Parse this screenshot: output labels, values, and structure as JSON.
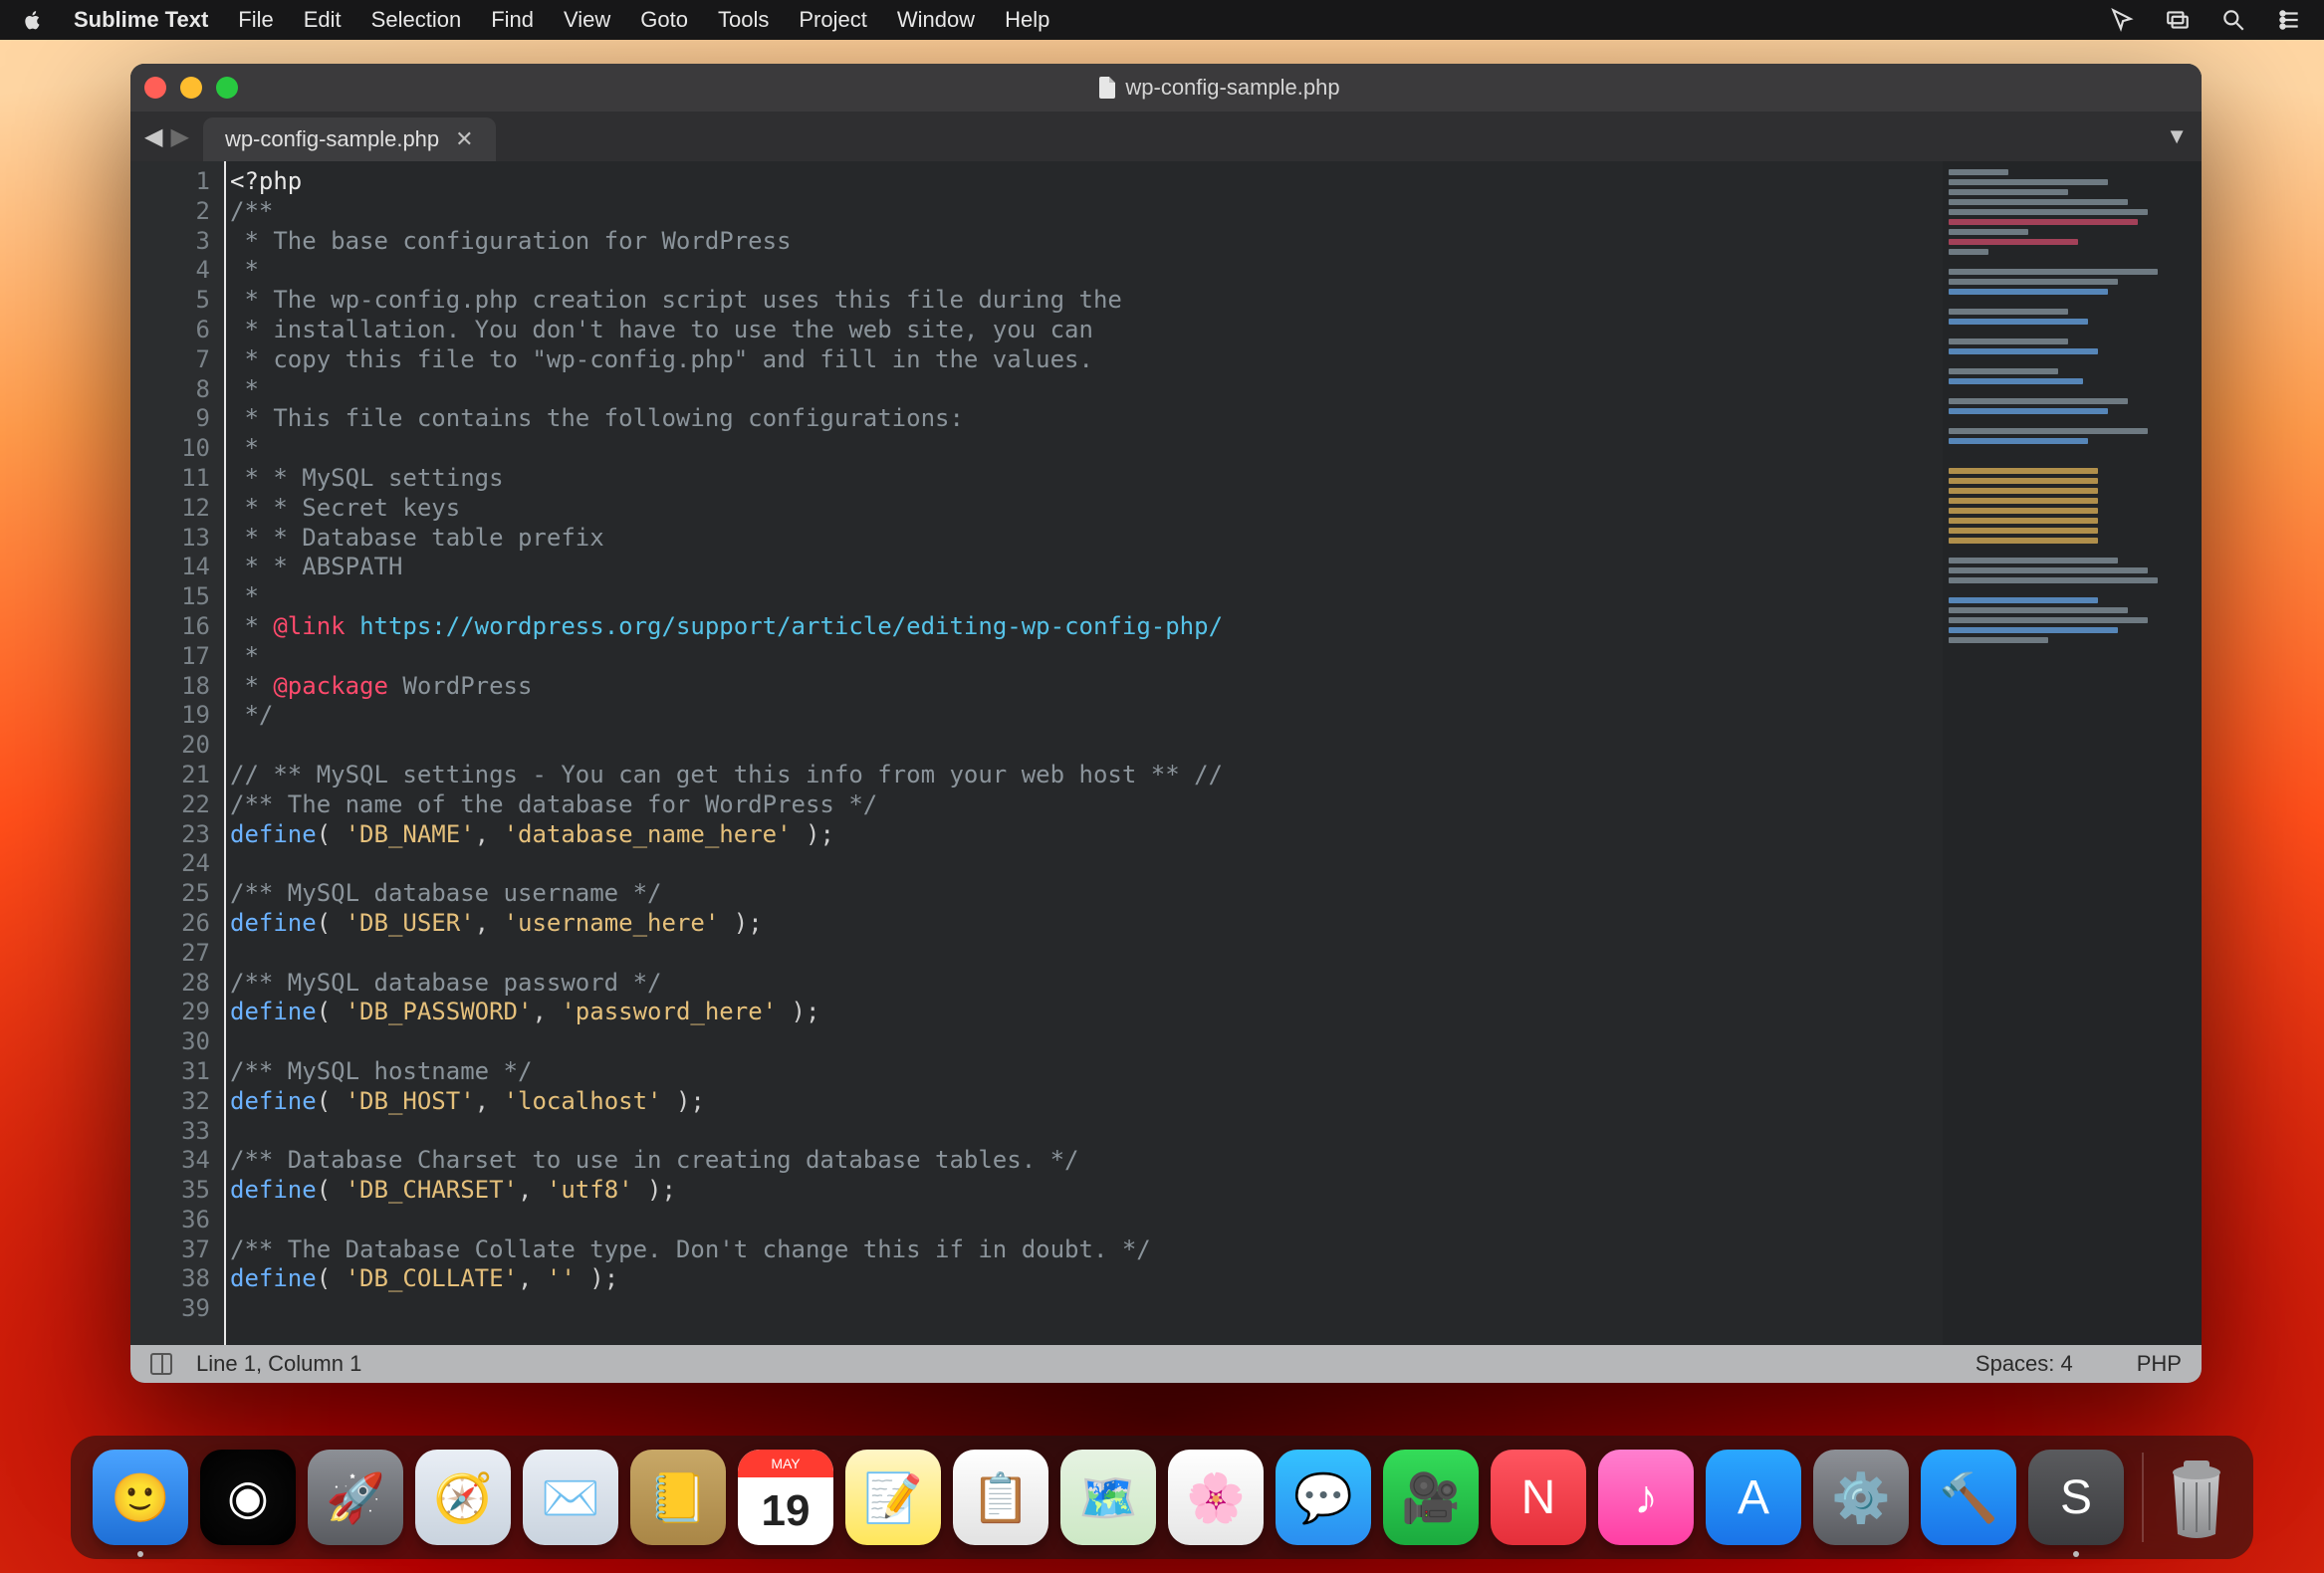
{
  "menubar": {
    "app_name": "Sublime Text",
    "items": [
      "File",
      "Edit",
      "Selection",
      "Find",
      "View",
      "Goto",
      "Tools",
      "Project",
      "Window",
      "Help"
    ]
  },
  "window": {
    "title": "wp-config-sample.php",
    "tab_name": "wp-config-sample.php"
  },
  "code": {
    "lines": [
      {
        "n": 1,
        "seg": [
          {
            "t": "<?php",
            "cls": "c-php"
          }
        ]
      },
      {
        "n": 2,
        "seg": [
          {
            "t": "/**",
            "cls": "c-comment"
          }
        ]
      },
      {
        "n": 3,
        "seg": [
          {
            "t": " * The base configuration for WordPress",
            "cls": "c-comment"
          }
        ]
      },
      {
        "n": 4,
        "seg": [
          {
            "t": " *",
            "cls": "c-comment"
          }
        ]
      },
      {
        "n": 5,
        "seg": [
          {
            "t": " * The wp-config.php creation script uses this file during the",
            "cls": "c-comment"
          }
        ]
      },
      {
        "n": 6,
        "seg": [
          {
            "t": " * installation. You don't have to use the web site, you can",
            "cls": "c-comment"
          }
        ]
      },
      {
        "n": 7,
        "seg": [
          {
            "t": " * copy this file to \"wp-config.php\" and fill in the values.",
            "cls": "c-comment"
          }
        ]
      },
      {
        "n": 8,
        "seg": [
          {
            "t": " *",
            "cls": "c-comment"
          }
        ]
      },
      {
        "n": 9,
        "seg": [
          {
            "t": " * This file contains the following configurations:",
            "cls": "c-comment"
          }
        ]
      },
      {
        "n": 10,
        "seg": [
          {
            "t": " *",
            "cls": "c-comment"
          }
        ]
      },
      {
        "n": 11,
        "seg": [
          {
            "t": " * * MySQL settings",
            "cls": "c-comment"
          }
        ]
      },
      {
        "n": 12,
        "seg": [
          {
            "t": " * * Secret keys",
            "cls": "c-comment"
          }
        ]
      },
      {
        "n": 13,
        "seg": [
          {
            "t": " * * Database table prefix",
            "cls": "c-comment"
          }
        ]
      },
      {
        "n": 14,
        "seg": [
          {
            "t": " * * ABSPATH",
            "cls": "c-comment"
          }
        ]
      },
      {
        "n": 15,
        "seg": [
          {
            "t": " *",
            "cls": "c-comment"
          }
        ]
      },
      {
        "n": 16,
        "seg": [
          {
            "t": " * ",
            "cls": "c-comment"
          },
          {
            "t": "@link",
            "cls": "c-ann"
          },
          {
            "t": " ",
            "cls": "c-comment"
          },
          {
            "t": "https://wordpress.org/support/article/editing-wp-config-php/",
            "cls": "c-url"
          }
        ]
      },
      {
        "n": 17,
        "seg": [
          {
            "t": " *",
            "cls": "c-comment"
          }
        ]
      },
      {
        "n": 18,
        "seg": [
          {
            "t": " * ",
            "cls": "c-comment"
          },
          {
            "t": "@package",
            "cls": "c-ann"
          },
          {
            "t": " WordPress",
            "cls": "c-comment"
          }
        ]
      },
      {
        "n": 19,
        "seg": [
          {
            "t": " */",
            "cls": "c-comment"
          }
        ]
      },
      {
        "n": 20,
        "seg": [
          {
            "t": "",
            "cls": ""
          }
        ]
      },
      {
        "n": 21,
        "seg": [
          {
            "t": "// ** MySQL settings - You can get this info from your web host ** //",
            "cls": "c-comment"
          }
        ]
      },
      {
        "n": 22,
        "seg": [
          {
            "t": "/** The name of the database for WordPress */",
            "cls": "c-comment"
          }
        ]
      },
      {
        "n": 23,
        "seg": [
          {
            "t": "define",
            "cls": "c-kw"
          },
          {
            "t": "( ",
            "cls": "c-punc"
          },
          {
            "t": "'DB_NAME'",
            "cls": "c-str"
          },
          {
            "t": ", ",
            "cls": "c-punc"
          },
          {
            "t": "'database_name_here'",
            "cls": "c-str"
          },
          {
            "t": " );",
            "cls": "c-punc"
          }
        ]
      },
      {
        "n": 24,
        "seg": [
          {
            "t": "",
            "cls": ""
          }
        ]
      },
      {
        "n": 25,
        "seg": [
          {
            "t": "/** MySQL database username */",
            "cls": "c-comment"
          }
        ]
      },
      {
        "n": 26,
        "seg": [
          {
            "t": "define",
            "cls": "c-kw"
          },
          {
            "t": "( ",
            "cls": "c-punc"
          },
          {
            "t": "'DB_USER'",
            "cls": "c-str"
          },
          {
            "t": ", ",
            "cls": "c-punc"
          },
          {
            "t": "'username_here'",
            "cls": "c-str"
          },
          {
            "t": " );",
            "cls": "c-punc"
          }
        ]
      },
      {
        "n": 27,
        "seg": [
          {
            "t": "",
            "cls": ""
          }
        ]
      },
      {
        "n": 28,
        "seg": [
          {
            "t": "/** MySQL database password */",
            "cls": "c-comment"
          }
        ]
      },
      {
        "n": 29,
        "seg": [
          {
            "t": "define",
            "cls": "c-kw"
          },
          {
            "t": "( ",
            "cls": "c-punc"
          },
          {
            "t": "'DB_PASSWORD'",
            "cls": "c-str"
          },
          {
            "t": ", ",
            "cls": "c-punc"
          },
          {
            "t": "'password_here'",
            "cls": "c-str"
          },
          {
            "t": " );",
            "cls": "c-punc"
          }
        ]
      },
      {
        "n": 30,
        "seg": [
          {
            "t": "",
            "cls": ""
          }
        ]
      },
      {
        "n": 31,
        "seg": [
          {
            "t": "/** MySQL hostname */",
            "cls": "c-comment"
          }
        ]
      },
      {
        "n": 32,
        "seg": [
          {
            "t": "define",
            "cls": "c-kw"
          },
          {
            "t": "( ",
            "cls": "c-punc"
          },
          {
            "t": "'DB_HOST'",
            "cls": "c-str"
          },
          {
            "t": ", ",
            "cls": "c-punc"
          },
          {
            "t": "'localhost'",
            "cls": "c-str"
          },
          {
            "t": " );",
            "cls": "c-punc"
          }
        ]
      },
      {
        "n": 33,
        "seg": [
          {
            "t": "",
            "cls": ""
          }
        ]
      },
      {
        "n": 34,
        "seg": [
          {
            "t": "/** Database Charset to use in creating database tables. */",
            "cls": "c-comment"
          }
        ]
      },
      {
        "n": 35,
        "seg": [
          {
            "t": "define",
            "cls": "c-kw"
          },
          {
            "t": "( ",
            "cls": "c-punc"
          },
          {
            "t": "'DB_CHARSET'",
            "cls": "c-str"
          },
          {
            "t": ", ",
            "cls": "c-punc"
          },
          {
            "t": "'utf8'",
            "cls": "c-str"
          },
          {
            "t": " );",
            "cls": "c-punc"
          }
        ]
      },
      {
        "n": 36,
        "seg": [
          {
            "t": "",
            "cls": ""
          }
        ]
      },
      {
        "n": 37,
        "seg": [
          {
            "t": "/** The Database Collate type. Don't change this if in doubt. */",
            "cls": "c-comment"
          }
        ]
      },
      {
        "n": 38,
        "seg": [
          {
            "t": "define",
            "cls": "c-kw"
          },
          {
            "t": "( ",
            "cls": "c-punc"
          },
          {
            "t": "'DB_COLLATE'",
            "cls": "c-str"
          },
          {
            "t": ", ",
            "cls": "c-punc"
          },
          {
            "t": "''",
            "cls": "c-str"
          },
          {
            "t": " );",
            "cls": "c-punc"
          }
        ]
      },
      {
        "n": 39,
        "seg": [
          {
            "t": "",
            "cls": ""
          }
        ]
      }
    ]
  },
  "status": {
    "left": "Line 1, Column 1",
    "spaces": "Spaces: 4",
    "syntax": "PHP"
  },
  "calendar": {
    "month": "MAY",
    "day": "19"
  },
  "dock_items": [
    {
      "name": "finder",
      "glyph": "🙂",
      "bg": "linear-gradient(180deg,#4aa3ff,#1e6fd6)",
      "dot": true
    },
    {
      "name": "siri",
      "glyph": "◉",
      "bg": "radial-gradient(circle,#0b0b0b,#000)",
      "dot": false
    },
    {
      "name": "launchpad",
      "glyph": "🚀",
      "bg": "linear-gradient(180deg,#8d9096,#595b60)",
      "dot": false
    },
    {
      "name": "safari",
      "glyph": "🧭",
      "bg": "linear-gradient(180deg,#e9eef5,#c9d3de)",
      "dot": false
    },
    {
      "name": "mail",
      "glyph": "✉️",
      "bg": "linear-gradient(180deg,#e9eef5,#c9d3de)",
      "dot": false
    },
    {
      "name": "contacts",
      "glyph": "📒",
      "bg": "linear-gradient(180deg,#c8a867,#a98646)",
      "dot": false
    },
    {
      "name": "calendar",
      "glyph": "",
      "bg": "#fff",
      "dot": false,
      "calendar": true
    },
    {
      "name": "notes",
      "glyph": "📝",
      "bg": "linear-gradient(180deg,#fff6c6,#ffe65a)",
      "dot": false
    },
    {
      "name": "reminders",
      "glyph": "📋",
      "bg": "linear-gradient(180deg,#fff,#e2e2e2)",
      "dot": false
    },
    {
      "name": "maps",
      "glyph": "🗺️",
      "bg": "linear-gradient(180deg,#e6f3e2,#cde8c5)",
      "dot": false
    },
    {
      "name": "photos",
      "glyph": "🌸",
      "bg": "linear-gradient(180deg,#fff,#e6e6e6)",
      "dot": false
    },
    {
      "name": "messages",
      "glyph": "💬",
      "bg": "linear-gradient(180deg,#34c2ff,#2b8ef0)",
      "dot": false
    },
    {
      "name": "facetime",
      "glyph": "🎥",
      "bg": "linear-gradient(180deg,#34dc59,#1baa3e)",
      "dot": false
    },
    {
      "name": "news",
      "glyph": "N",
      "bg": "linear-gradient(180deg,#ff5560,#e52f3a)",
      "dot": false
    },
    {
      "name": "itunes",
      "glyph": "♪",
      "bg": "linear-gradient(180deg,#ff7fcf,#ff3ea3)",
      "dot": false
    },
    {
      "name": "appstore",
      "glyph": "A",
      "bg": "linear-gradient(180deg,#2aa8ff,#1a73e8)",
      "dot": false
    },
    {
      "name": "systemprefs",
      "glyph": "⚙️",
      "bg": "linear-gradient(180deg,#8d9096,#595b60)",
      "dot": false
    },
    {
      "name": "xcode",
      "glyph": "🔨",
      "bg": "linear-gradient(180deg,#2aa8ff,#1a73e8)",
      "dot": false
    },
    {
      "name": "sublime",
      "glyph": "S",
      "bg": "linear-gradient(180deg,#5a5b5e,#3b3c3f)",
      "dot": true
    }
  ]
}
